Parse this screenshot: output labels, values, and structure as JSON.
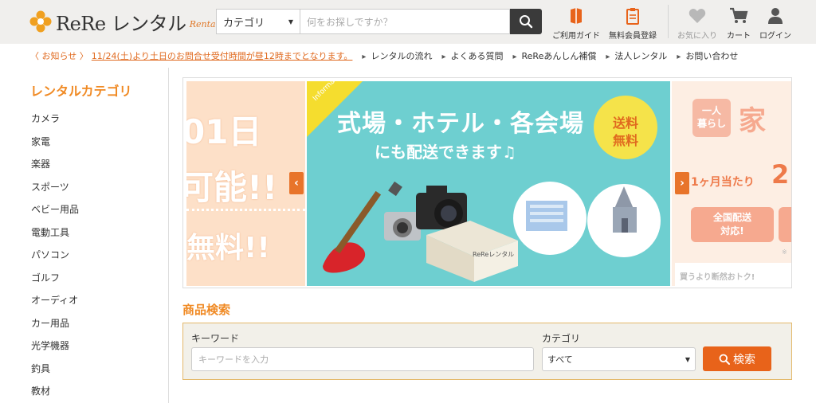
{
  "brand": {
    "name": "ReRe レンタル",
    "sub": "Rental"
  },
  "search": {
    "category": "カテゴリ",
    "placeholder": "何をお探しですか？"
  },
  "header_nav": {
    "guide": "ご利用ガイド",
    "register": "無料会員登録",
    "favorites": "お気に入り",
    "cart": "カート",
    "login": "ログイン"
  },
  "notice": {
    "prefix": "〈 お知らせ 〉",
    "message": "11/24(土)より土日のお問合せ受付時間が昼12時までとなります。",
    "links": [
      "レンタルの流れ",
      "よくある質問",
      "ReReあんしん補償",
      "法人レンタル",
      "お問い合わせ"
    ]
  },
  "sidebar": {
    "title": "レンタルカテゴリ",
    "items": [
      "カメラ",
      "家電",
      "楽器",
      "スポーツ",
      "ベビー用品",
      "電動工具",
      "パソコン",
      "ゴルフ",
      "オーディオ",
      "カー用品",
      "光学機器",
      "釣具",
      "教材"
    ]
  },
  "carousel": {
    "left": {
      "line1": "01日",
      "line2": "可能!!",
      "line3": "無料!!"
    },
    "main": {
      "ribbon": "Information",
      "headline": "式場・ホテル・各会場",
      "subline": "にも配送できます♫",
      "badge1": "送料",
      "badge2": "無料",
      "box_label": "ReReレンタル",
      "hotel_label": "HOTEL"
    },
    "right": {
      "tag1": "一人",
      "tag2": "暮らし",
      "word": "家",
      "price": "1ヶ月当たり",
      "price_num": "2",
      "ship1": "全国配送",
      "ship2": "対応!",
      "note": "※",
      "footer": "買うより断然おトク!"
    }
  },
  "product_search": {
    "title": "商品検索",
    "keyword_label": "キーワード",
    "keyword_placeholder": "キーワードを入力",
    "category_label": "カテゴリ",
    "category_value": "すべて",
    "button": "検索"
  },
  "colors": {
    "accent": "#f08a24",
    "button": "#e8631a",
    "teal": "#6ecfd0"
  }
}
